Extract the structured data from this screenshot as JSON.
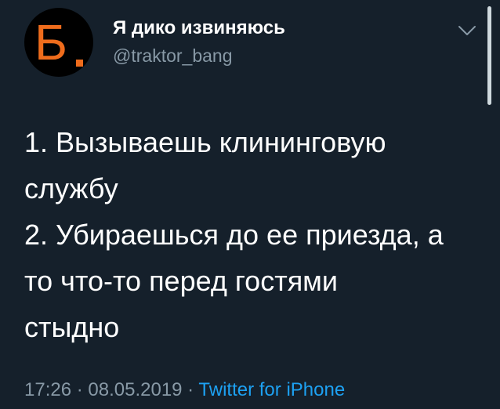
{
  "tweet": {
    "avatar_letter": "Б",
    "display_name": "Я дико извиняюсь",
    "handle": "@traktor_bang",
    "text_lines": [
      "1. Вызываешь клининговую",
      "службу",
      "2. Убираешься до ее приезда, а",
      "то что-то перед гостями",
      "стыдно"
    ],
    "time": "17:26",
    "separator": " · ",
    "date": "08.05.2019",
    "source": "Twitter for iPhone"
  },
  "colors": {
    "background": "#15202b",
    "accent": "#1da1f2",
    "avatar_orange": "#ef6c1c",
    "secondary_text": "#8899a6"
  },
  "icons": {
    "more": "chevron-down-icon"
  }
}
